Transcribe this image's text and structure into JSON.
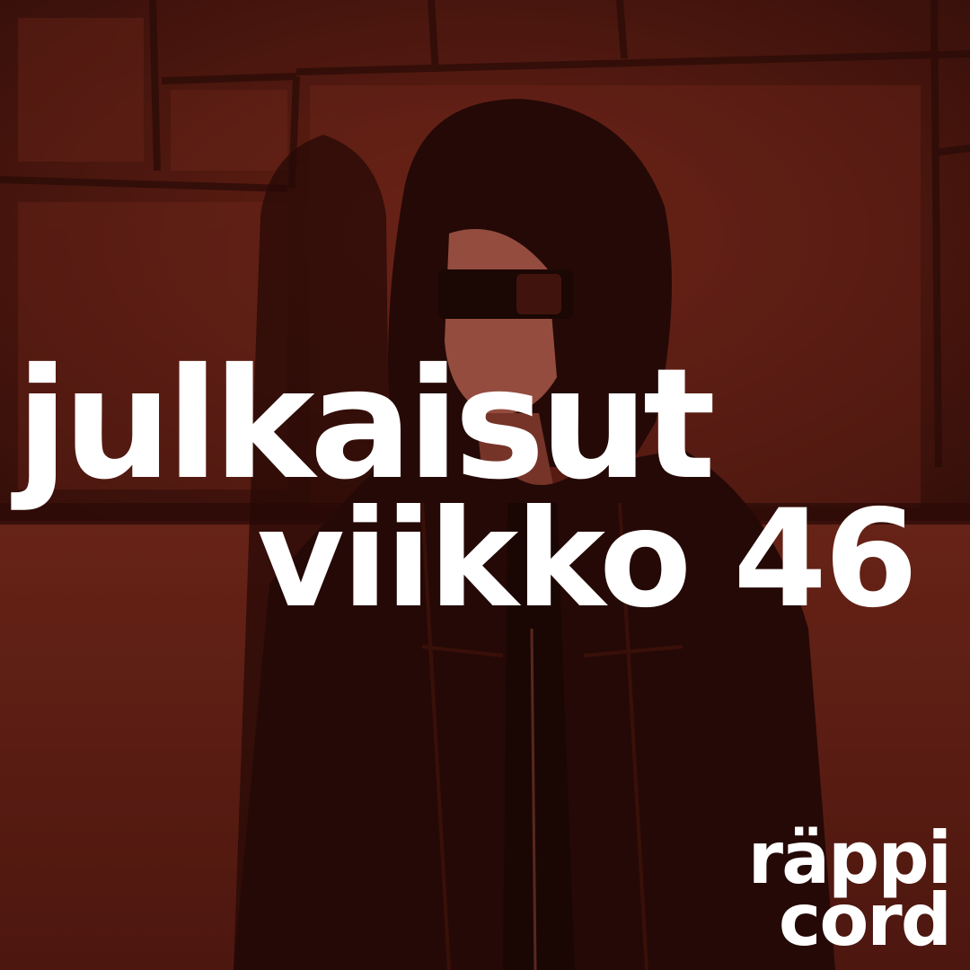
{
  "poster": {
    "headline_line1": "julkaisut",
    "headline_line2": "viikko 46",
    "logo_line1": "räppi",
    "logo_line2": "cord"
  },
  "colors": {
    "tint": "#5a1b12",
    "text": "#ffffff"
  }
}
